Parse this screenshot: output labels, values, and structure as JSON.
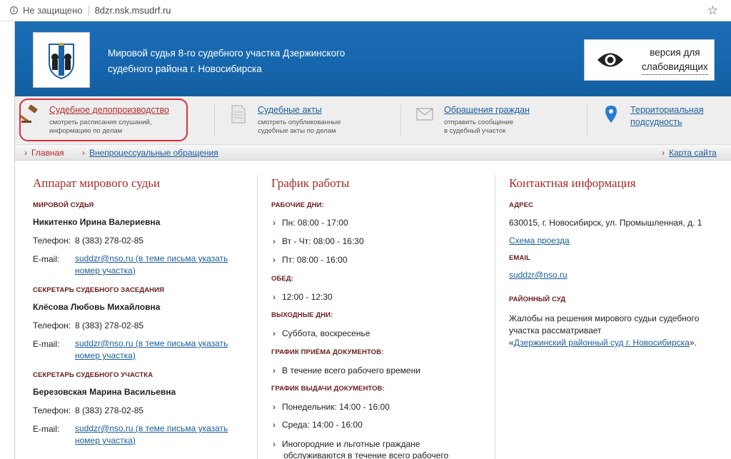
{
  "browser": {
    "secure_label": "Не защищено",
    "url": "8dzr.nsk.msudrf.ru"
  },
  "header": {
    "title": "Мировой судья 8-го судебного участка Дзержинского судебного района г. Новосибирска",
    "vision_line1": "версия для",
    "vision_line2": "слабовидящих"
  },
  "quicknav": [
    {
      "label": "Судебное делопроизводство",
      "desc1": "смотреть расписания слушаний,",
      "desc2": "информацию по делам",
      "icon": "gavel-icon"
    },
    {
      "label": "Судебные акты",
      "desc1": "смотреть опубликованные",
      "desc2": "судебные акты по делам",
      "icon": "document-icon"
    },
    {
      "label": "Обращения граждан",
      "desc1": "отправить сообщение",
      "desc2": "в судебный участок",
      "icon": "envelope-icon"
    },
    {
      "label1": "Территориальная",
      "label2": "подсудность",
      "icon": "map-pin-icon"
    }
  ],
  "breadcrumbs": {
    "home": "Главная",
    "extra": "Внепроцессуальные обращения",
    "sitemap": "Карта сайта"
  },
  "apparatus": {
    "title": "Аппарат мирового судьи",
    "judge_label": "МИРОВОЙ СУДЬЯ",
    "judge_name": "Никитенко Ирина Валериевна",
    "secretary_label": "СЕКРЕТАРЬ СУДЕБНОГО ЗАСЕДАНИЯ",
    "secretary_name": "Клёсова Любовь Михайловна",
    "section_secretary_label": "СЕКРЕТАРЬ СУДЕБНОГО УЧАСТКА",
    "section_secretary_name": "Березовская Марина Васильевна",
    "phone_label": "Телефон:",
    "phone": "8 (383) 278-02-85",
    "email_label": "E-mail:",
    "email_line1": "suddzr@nso.ru (в теме письма указать",
    "email_line2": "номер участка)"
  },
  "schedule": {
    "title": "График работы",
    "workdays_label": "РАБОЧИЕ ДНИ:",
    "mon": "Пн: 08:00 - 17:00",
    "tue_thu": "Вт - Чт: 08:00 - 16:30",
    "fri": "Пт: 08:00 - 16:00",
    "lunch_label": "ОБЕД:",
    "lunch": "12:00 - 12:30",
    "weekend_label": "ВЫХОДНЫЕ ДНИ:",
    "weekend": "Суббота, воскресенье",
    "docs_in_label": "ГРАФИК ПРИЁМА ДОКУМЕНТОВ:",
    "docs_in": "В течение всего рабочего времени",
    "docs_out_label": "ГРАФИК ВЫДАЧИ ДОКУМЕНТОВ:",
    "docs_out_mon": "Понедельник: 14:00 - 16:00",
    "docs_out_wed": "Среда: 14:00 - 16:00",
    "nonresident_line1": "Иногородние и льготные граждане",
    "nonresident_line2": "обслуживаются в течение всего рабочего"
  },
  "contacts": {
    "title": "Контактная информация",
    "address_label": "АДРЕС",
    "address": "630015, г. Новосибирск, ул. Промышленная, д. 1",
    "route_link": "Схема проезда",
    "email_label": "EMAIL",
    "email": "suddzr@nso.ru",
    "district_label": "РАЙОННЫЙ СУД",
    "district_line1": "Жалобы на решения мирового судьи судебного",
    "district_line2": "участка рассматривает",
    "district_quote_open": "«",
    "district_link": "Дзержинский районный суд г. Новосибирска",
    "district_quote_close": "»."
  }
}
